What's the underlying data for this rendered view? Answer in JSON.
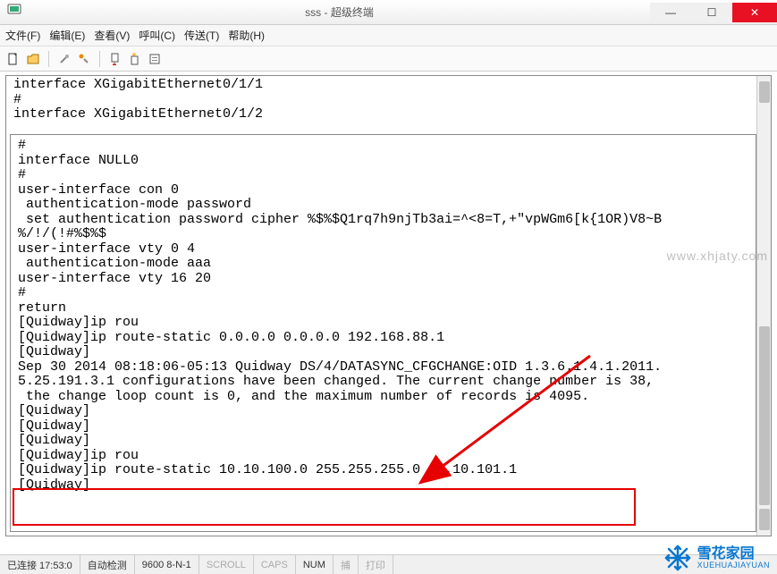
{
  "window": {
    "title": "sss - 超级终端"
  },
  "menu": {
    "file": "文件(F)",
    "edit": "编辑(E)",
    "view": "查看(V)",
    "call": "呼叫(C)",
    "transfer": "传送(T)",
    "help": "帮助(H)"
  },
  "terminal": {
    "top_lines": "interface XGigabitEthernet0/1/1\n#\ninterface XGigabitEthernet0/1/2",
    "body": "#\ninterface NULL0\n#\nuser-interface con 0\n authentication-mode password\n set authentication password cipher %$%$Q1rq7h9njTb3ai=^<8=T,+\"vpWGm6[k{1OR)V8~B\n%/!/(!#%$%$\nuser-interface vty 0 4\n authentication-mode aaa\nuser-interface vty 16 20\n#\nreturn\n[Quidway]ip rou\n[Quidway]ip route-static 0.0.0.0 0.0.0.0 192.168.88.1\n[Quidway]\nSep 30 2014 08:18:06-05:13 Quidway DS/4/DATASYNC_CFGCHANGE:OID 1.3.6.1.4.1.2011.\n5.25.191.3.1 configurations have been changed. The current change number is 38,\n the change loop count is 0, and the maximum number of records is 4095.\n[Quidway]\n[Quidway]\n[Quidway]\n[Quidway]ip rou\n[Quidway]ip route-static 10.10.100.0 255.255.255.0 10.10.101.1\n[Quidway]_"
  },
  "status": {
    "connected": "已连接 17:53:0",
    "auto": "自动检测",
    "baud": "9600 8-N-1",
    "scroll": "SCROLL",
    "caps": "CAPS",
    "num": "NUM",
    "capture": "捕",
    "print": "打印"
  },
  "watermark": "www.xhjaty.com",
  "logo": {
    "cn": "雪花家园",
    "en": "XUEHUAJIAYUAN"
  }
}
